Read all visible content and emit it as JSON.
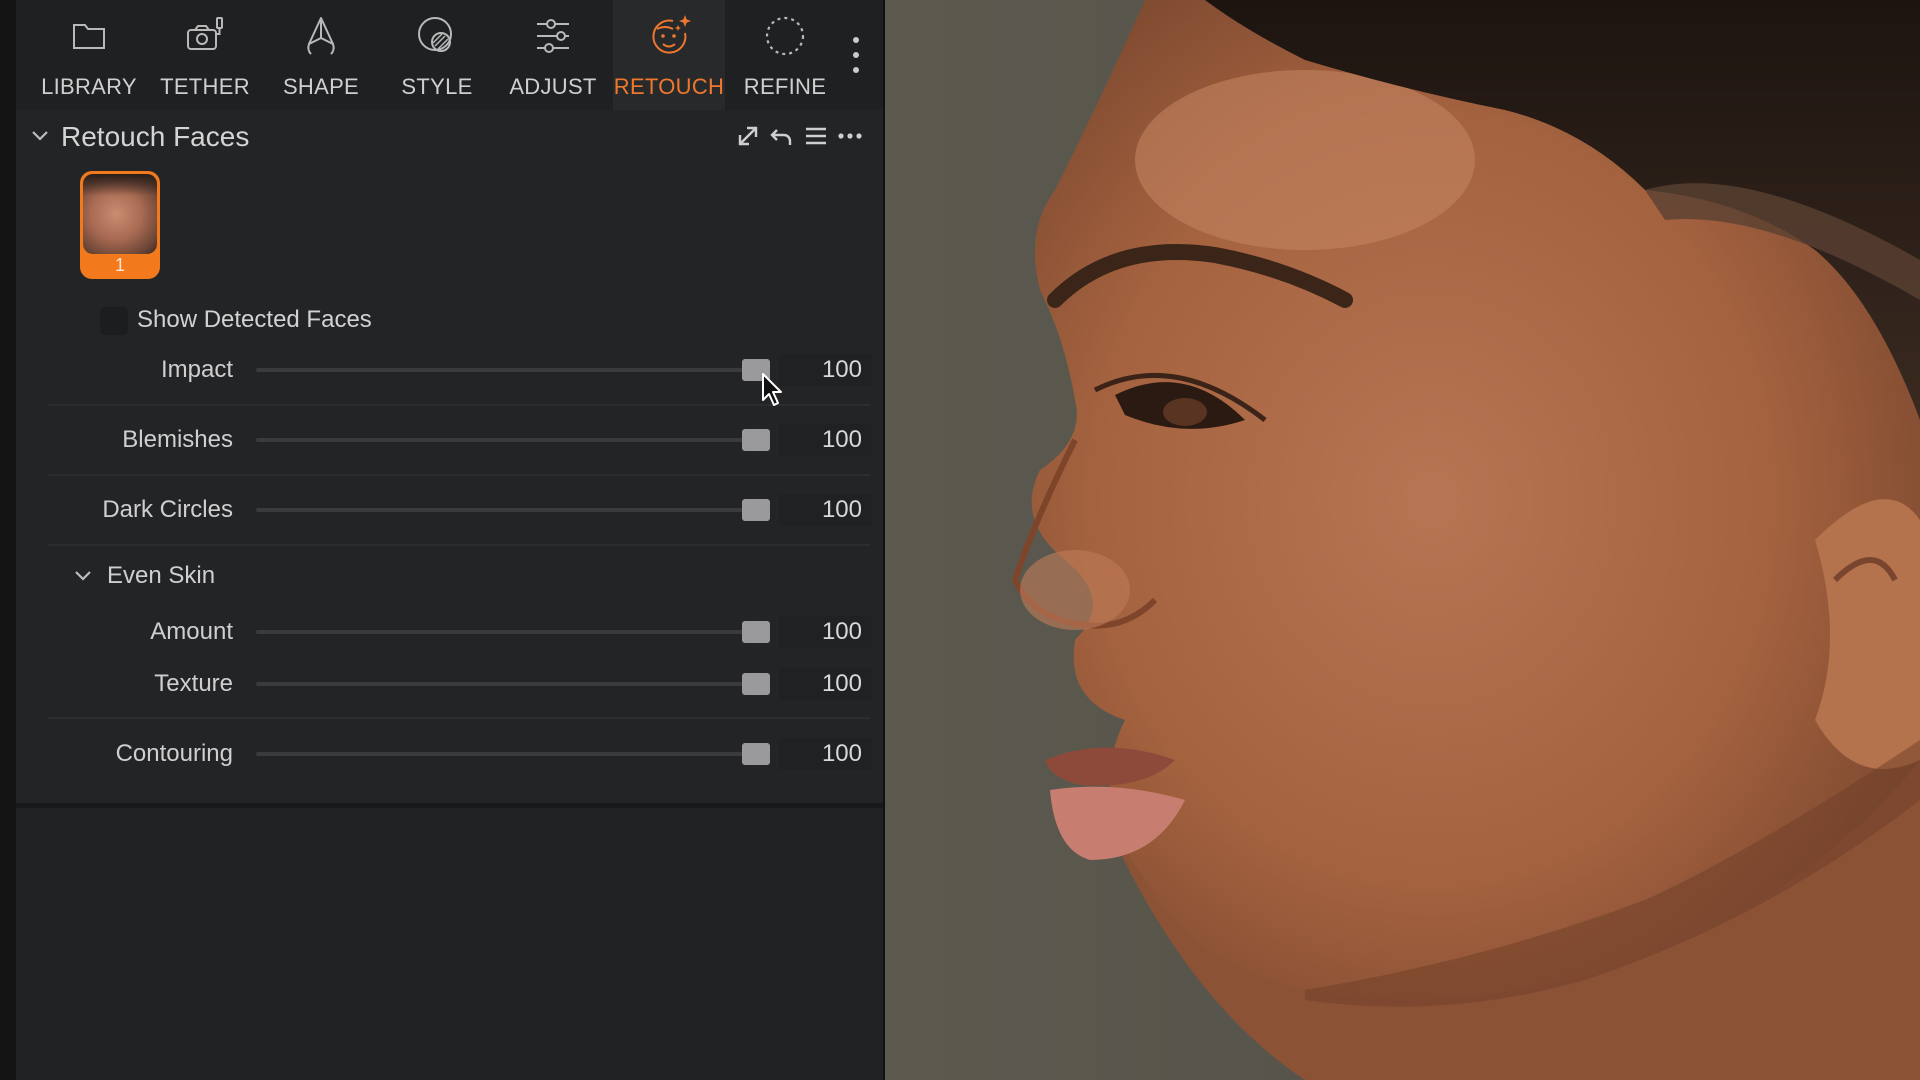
{
  "toolbar": {
    "tools": [
      {
        "label": "LIBRARY",
        "icon": "folder-icon"
      },
      {
        "label": "TETHER",
        "icon": "camera-icon"
      },
      {
        "label": "SHAPE",
        "icon": "shape-icon"
      },
      {
        "label": "STYLE",
        "icon": "style-icon"
      },
      {
        "label": "ADJUST",
        "icon": "sliders-icon"
      },
      {
        "label": "RETOUCH",
        "icon": "retouch-face-icon",
        "active": true
      },
      {
        "label": "REFINE",
        "icon": "refine-icon"
      }
    ],
    "more_icon": "vertical-ellipsis-icon"
  },
  "section": {
    "title": "Retouch Faces",
    "header_icons": [
      "expand-icon",
      "undo-icon",
      "list-icon",
      "more-icon"
    ]
  },
  "faces": {
    "items": [
      {
        "number": "1",
        "selected": true
      }
    ],
    "show_detected_label": "Show Detected Faces",
    "show_detected_checked": false
  },
  "sliders": {
    "impact": {
      "label": "Impact",
      "value": "100"
    },
    "blemishes": {
      "label": "Blemishes",
      "value": "100"
    },
    "dark_circles": {
      "label": "Dark Circles",
      "value": "100"
    },
    "amount": {
      "label": "Amount",
      "value": "100"
    },
    "texture": {
      "label": "Texture",
      "value": "100"
    },
    "contouring": {
      "label": "Contouring",
      "value": "100"
    }
  },
  "even_skin": {
    "title": "Even Skin",
    "expanded": true
  },
  "colors": {
    "accent": "#f0782e",
    "panel": "#232426",
    "track": "#3a3b3e",
    "thumb": "#9a9a9c"
  }
}
